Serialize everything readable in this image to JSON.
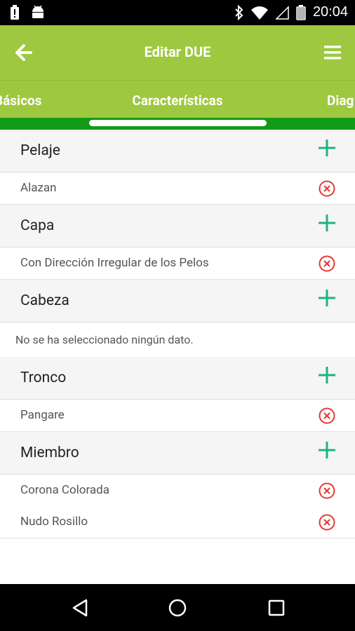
{
  "status_bar": {
    "time": "20:04"
  },
  "app_bar": {
    "title": "Editar DUE"
  },
  "tabs": [
    "Básicos",
    "Características",
    "Diag"
  ],
  "sections": [
    {
      "title": "Pelaje",
      "items": [
        "Alazan"
      ]
    },
    {
      "title": "Capa",
      "items": [
        "Con Dirección Irregular de los Pelos"
      ]
    },
    {
      "title": "Cabeza",
      "empty_text": "No se ha seleccionado ningún dato."
    },
    {
      "title": "Tronco",
      "items": [
        "Pangare"
      ]
    },
    {
      "title": "Miembro",
      "items": [
        "Corona Colorada",
        "Nudo Rosillo"
      ]
    }
  ],
  "colors": {
    "app_bar": "#9dc83f",
    "tab_indicator_bar": "#129b19",
    "add_icon": "#1fb27a",
    "remove_icon": "#e53935"
  }
}
